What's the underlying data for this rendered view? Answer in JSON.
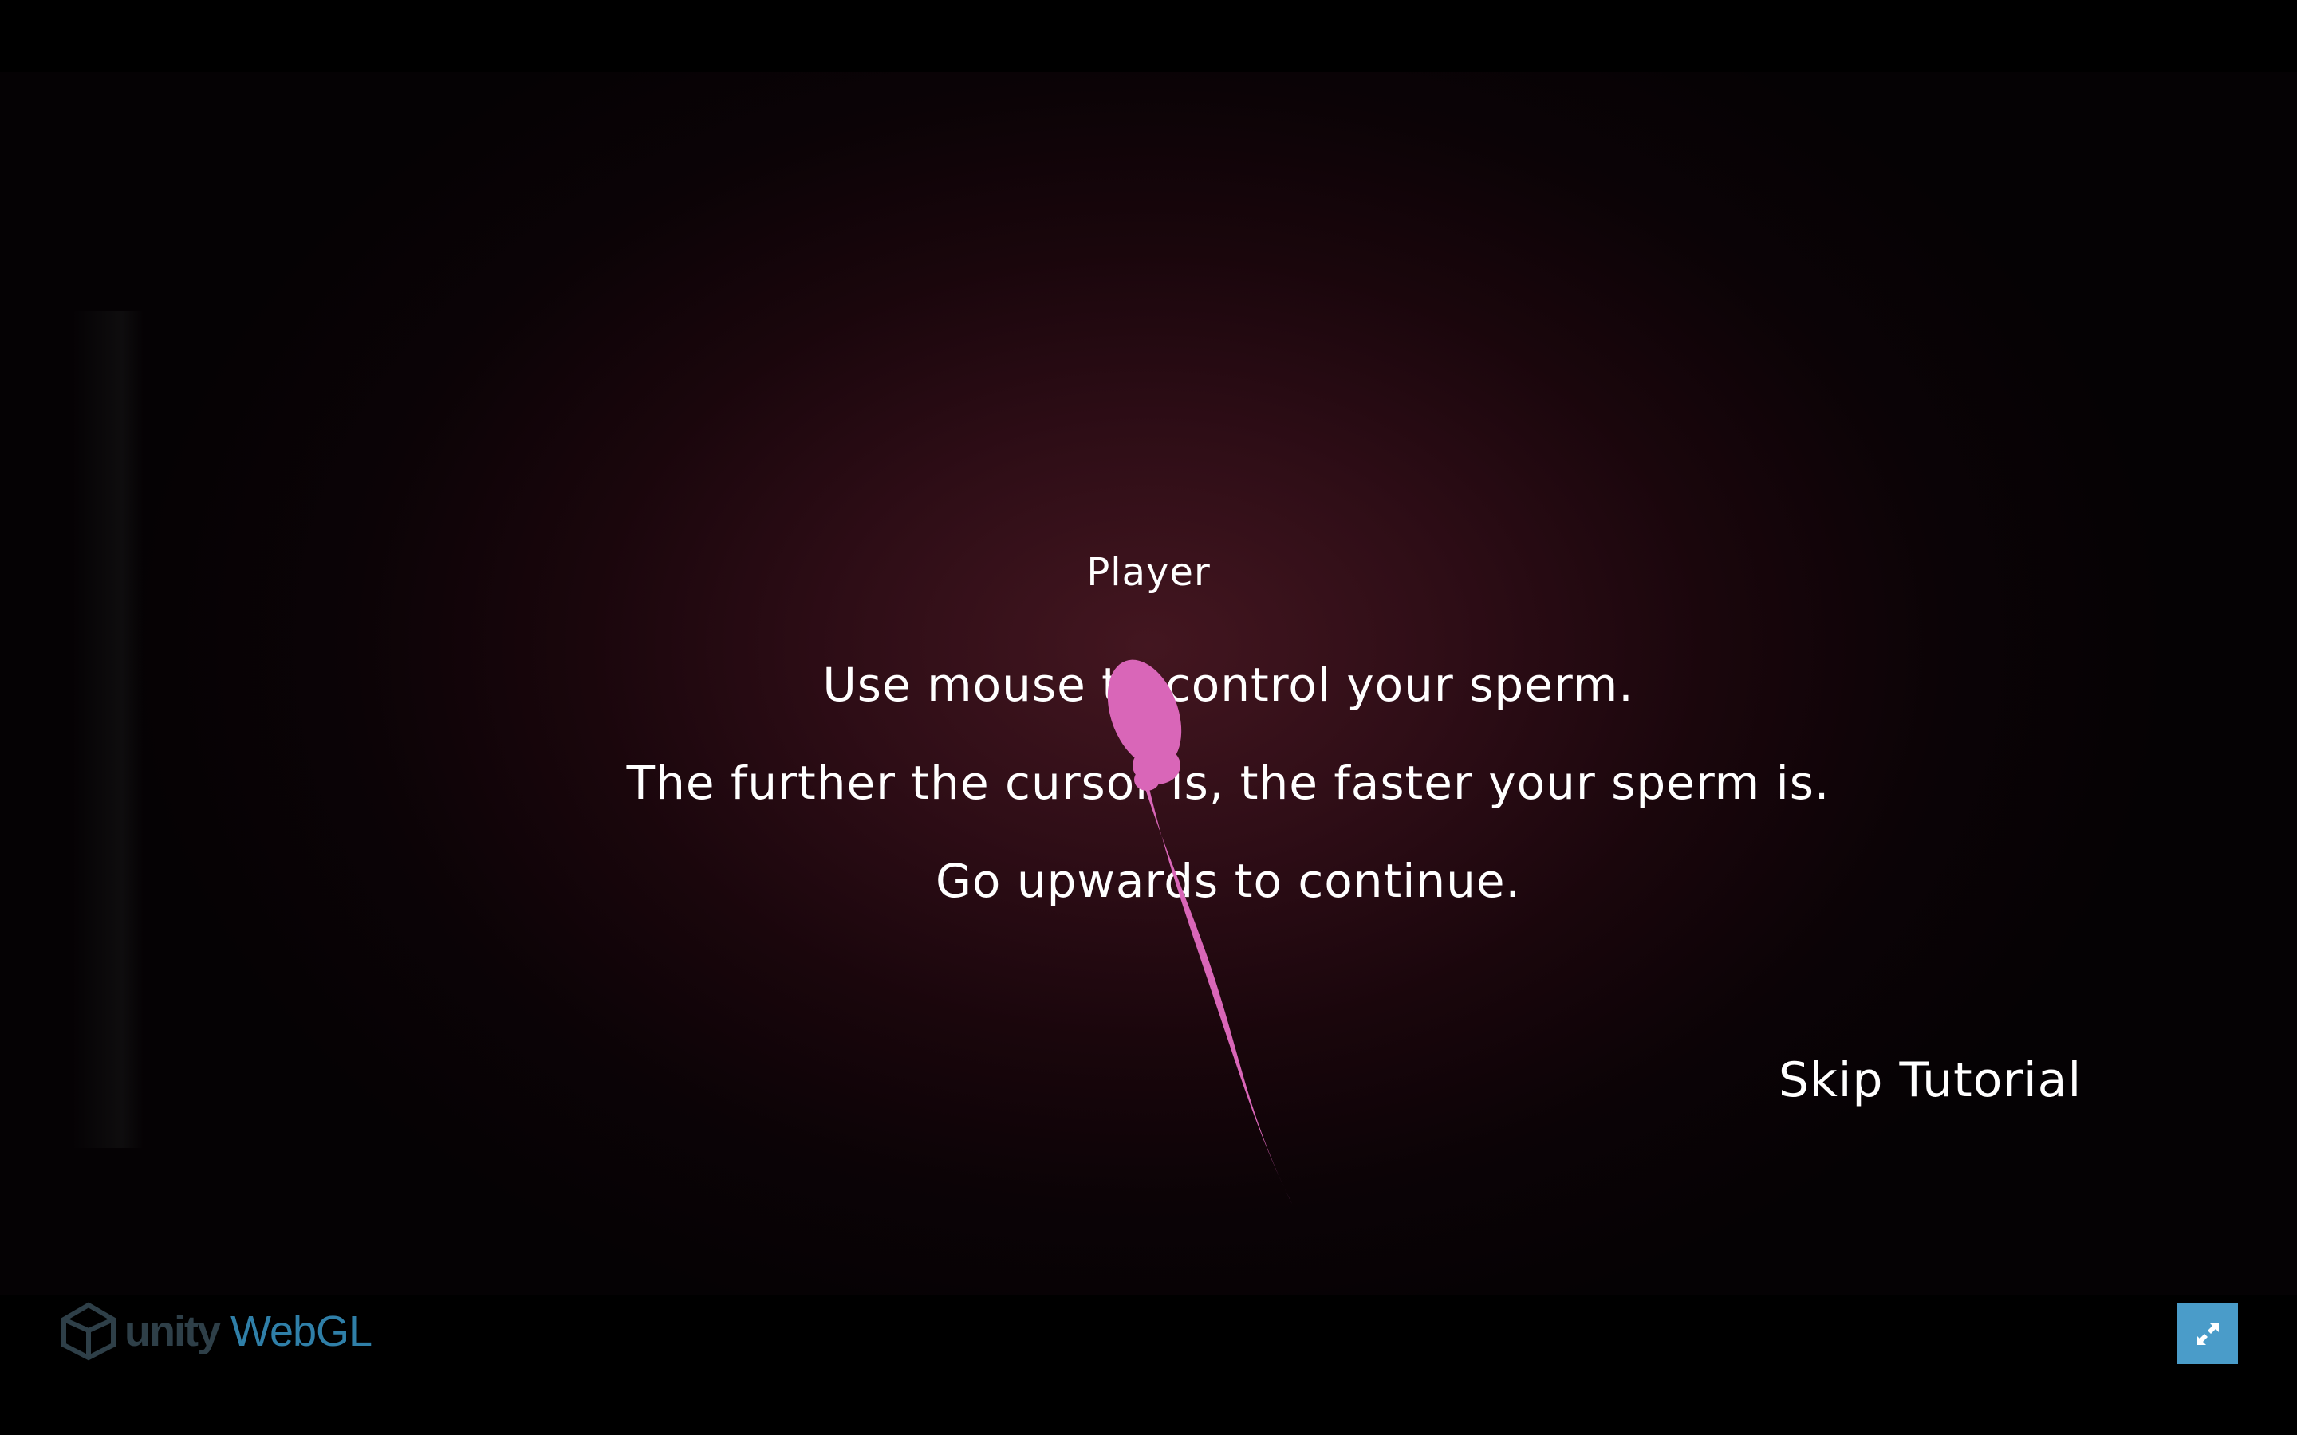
{
  "game": {
    "player_label": "Player",
    "instructions": {
      "line_1": "Use mouse to control your sperm.",
      "line_2": "The further the cursor is, the faster your sperm is.",
      "line_3": "Go upwards to continue."
    },
    "skip_tutorial": "Skip Tutorial",
    "sperm_color": "#d966b8",
    "background_glow_color": "#431620"
  },
  "footer": {
    "unity_text": "unity",
    "webgl_text": "WebGL",
    "unity_logo_icon": "unity-cube-icon",
    "fullscreen_icon": "expand-arrows-icon",
    "fullscreen_button_color": "#4a9cc9"
  }
}
